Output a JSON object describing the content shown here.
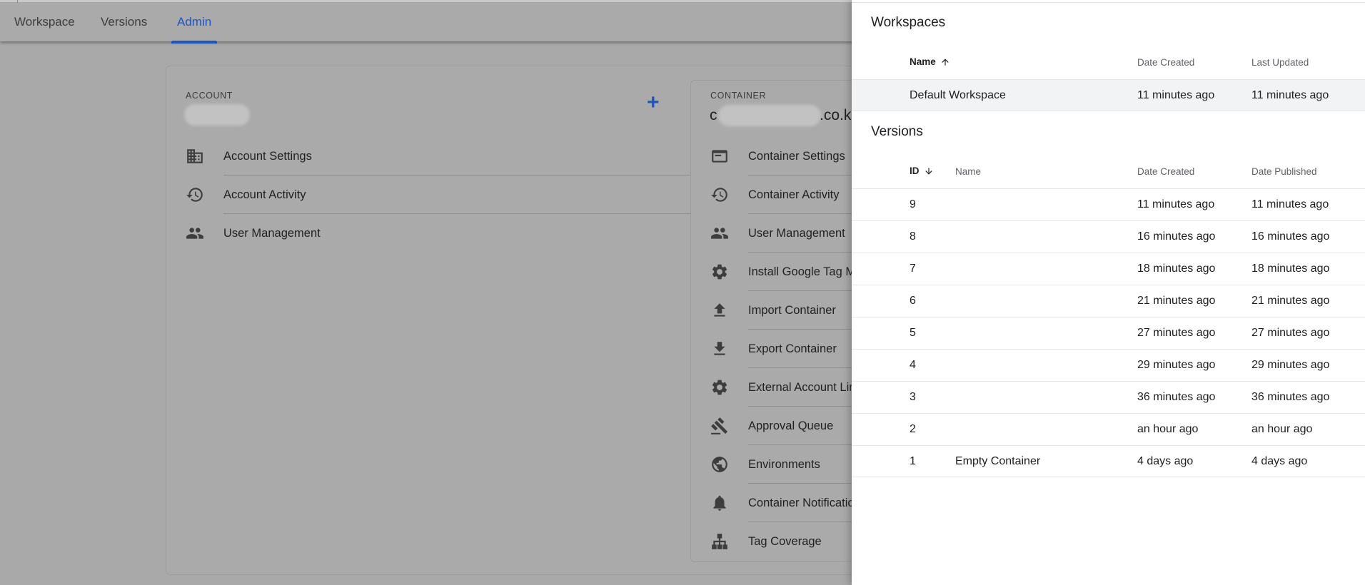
{
  "tabs": [
    {
      "label": "Workspace"
    },
    {
      "label": "Versions"
    },
    {
      "label": "Admin"
    }
  ],
  "account": {
    "label": "ACCOUNT",
    "add_label": "+",
    "items": [
      {
        "label": "Account Settings",
        "icon": "building-icon"
      },
      {
        "label": "Account Activity",
        "icon": "history-icon"
      },
      {
        "label": "User Management",
        "icon": "people-icon"
      }
    ]
  },
  "container": {
    "label": "CONTAINER",
    "name_start": "c",
    "name_end": ".co.k",
    "items": [
      {
        "label": "Container Settings",
        "icon": "browser-window-icon"
      },
      {
        "label": "Container Activity",
        "icon": "history-icon"
      },
      {
        "label": "User Management",
        "icon": "people-icon"
      },
      {
        "label": "Install Google Tag M",
        "icon": "gear-icon"
      },
      {
        "label": "Import Container",
        "icon": "upload-icon"
      },
      {
        "label": "Export Container",
        "icon": "download-icon"
      },
      {
        "label": "External Account Lin",
        "icon": "gear-icon"
      },
      {
        "label": "Approval Queue",
        "icon": "gavel-icon"
      },
      {
        "label": "Environments",
        "icon": "globe-icon"
      },
      {
        "label": "Container Notificatio",
        "icon": "bell-icon"
      },
      {
        "label": "Tag Coverage",
        "icon": "sitemap-icon"
      }
    ]
  },
  "workspaces": {
    "title": "Workspaces",
    "columns": {
      "name": "Name",
      "date_created": "Date Created",
      "last_updated": "Last Updated"
    },
    "rows": [
      {
        "name": "Default Workspace",
        "date_created": "11 minutes ago",
        "last_updated": "11 minutes ago"
      }
    ]
  },
  "versions": {
    "title": "Versions",
    "columns": {
      "id": "ID",
      "name": "Name",
      "date_created": "Date Created",
      "date_published": "Date Published"
    },
    "rows": [
      {
        "id": "9",
        "name": "",
        "date_created": "11 minutes ago",
        "date_published": "11 minutes ago"
      },
      {
        "id": "8",
        "name": "",
        "date_created": "16 minutes ago",
        "date_published": "16 minutes ago"
      },
      {
        "id": "7",
        "name": "",
        "date_created": "18 minutes ago",
        "date_published": "18 minutes ago"
      },
      {
        "id": "6",
        "name": "",
        "date_created": "21 minutes ago",
        "date_published": "21 minutes ago"
      },
      {
        "id": "5",
        "name": "",
        "date_created": "27 minutes ago",
        "date_published": "27 minutes ago"
      },
      {
        "id": "4",
        "name": "",
        "date_created": "29 minutes ago",
        "date_published": "29 minutes ago"
      },
      {
        "id": "3",
        "name": "",
        "date_created": "36 minutes ago",
        "date_published": "36 minutes ago"
      },
      {
        "id": "2",
        "name": "",
        "date_created": "an hour ago",
        "date_published": "an hour ago"
      },
      {
        "id": "1",
        "name": "Empty Container",
        "date_created": "4 days ago",
        "date_published": "4 days ago"
      }
    ]
  },
  "colors": {
    "accent": "#1a57c4",
    "overlay": "#a9a9a9",
    "panel": "#ffffff"
  }
}
